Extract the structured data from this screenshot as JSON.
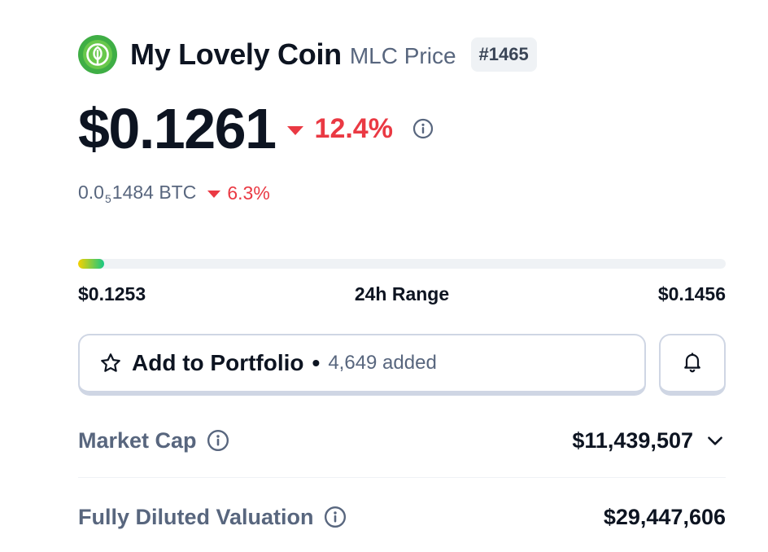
{
  "coin": {
    "name": "My Lovely Coin",
    "subtitle": "MLC Price",
    "rank": "#1465",
    "logo_icon": "sprout-leaf-icon",
    "logo_color": "#4fb848"
  },
  "price": {
    "value": "$0.1261",
    "change": "12.4%",
    "change_direction": "down",
    "change_color": "#ea3943",
    "info_icon": "info-circle-icon"
  },
  "btc": {
    "prefix": "0.0",
    "zeros": "5",
    "digits": "1484",
    "unit": " BTC",
    "change": "6.3%"
  },
  "range": {
    "low": "$0.1253",
    "label": "24h Range",
    "high": "$0.1456",
    "position_fraction": 0.04
  },
  "portfolio": {
    "label": "Add to Portfolio",
    "separator": "•",
    "count": "4,649 added",
    "star_icon": "star-outline-icon",
    "bell_icon": "bell-icon"
  },
  "stats": [
    {
      "label": "Market Cap",
      "value": "$11,439,507",
      "expandable": true
    },
    {
      "label": "Fully Diluted Valuation",
      "value": "$29,447,606",
      "expandable": false
    }
  ],
  "colors": {
    "text_primary": "#0d1421",
    "text_secondary": "#58667e",
    "negative": "#ea3943",
    "border": "#cfd6e4"
  }
}
